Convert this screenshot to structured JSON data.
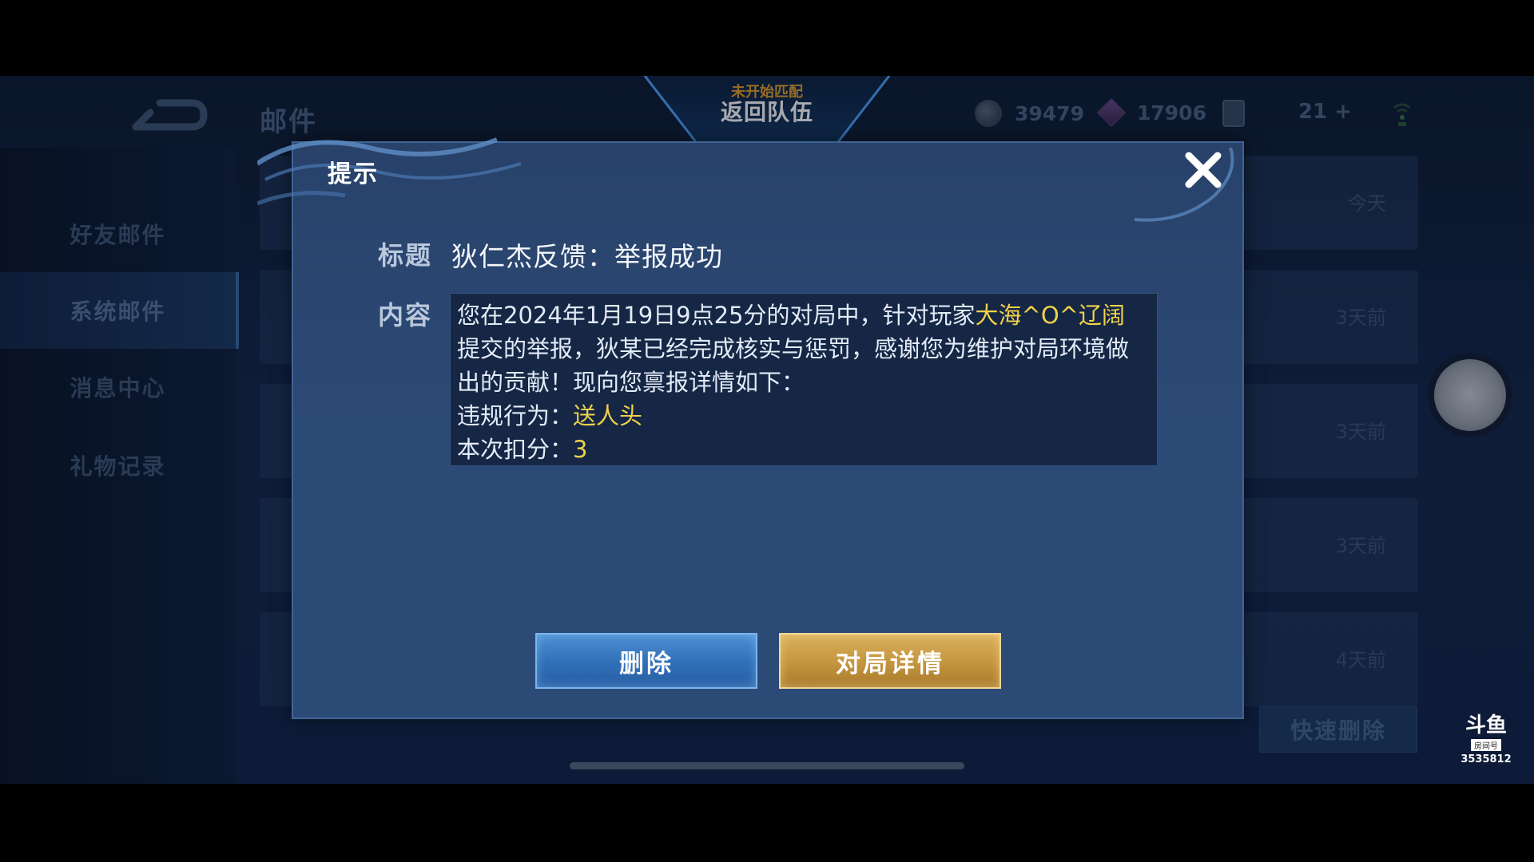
{
  "background": {
    "page_title": "邮件",
    "sidebar": [
      "好友邮件",
      "系统邮件",
      "消息中心",
      "礼物记录"
    ],
    "mail_dates": [
      "今天",
      "3天前",
      "3天前",
      "3天前",
      "4天前"
    ],
    "quick_delete": "快速删除",
    "gold": "39479",
    "diamonds": "17906",
    "plus_count": "21"
  },
  "team_banner": {
    "status": "未开始匹配",
    "return_label": "返回队伍"
  },
  "dialog": {
    "title": "提示",
    "subject_label": "标题",
    "subject": "狄仁杰反馈：举报成功",
    "content_label": "内容",
    "content": {
      "p1_a": "您在2024年1月19日9点25分的对局中，针对玩家",
      "player": "大海^O^辽阔",
      "p1_b": "提交的举报，狄某已经完成核实与惩罚，感谢您为维护对局环境做出的贡献！现向您禀报详情如下：",
      "violation_label": "违规行为：",
      "violation": "送人头",
      "deduction_label": "本次扣分：",
      "deduction": "3"
    },
    "delete_button": "删除",
    "detail_button": "对局详情"
  },
  "watermark": {
    "logo": "斗鱼",
    "label": "房间号",
    "room": "3535812"
  },
  "colors": {
    "highlight": "#f0d14a",
    "dialog_bg": "#2c4a76",
    "delete_btn": "#2f6fb7",
    "detail_btn": "#c4953f"
  }
}
